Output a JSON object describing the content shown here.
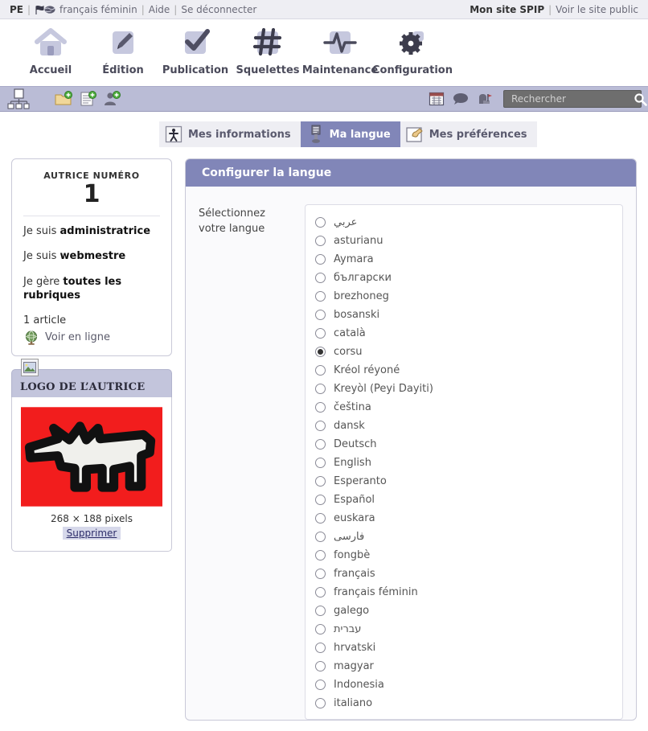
{
  "topbar": {
    "site_abbrev": "PE",
    "sep": "|",
    "language_link": "français féminin",
    "help_link": "Aide",
    "logout_link": "Se déconnecter",
    "site_name": "Mon site SPIP",
    "public_site_link": "Voir le site public",
    "flag_icon": "flags-icon"
  },
  "mainnav": [
    {
      "label": "Accueil",
      "icon": "home-icon"
    },
    {
      "label": "Édition",
      "icon": "pencil-icon"
    },
    {
      "label": "Publication",
      "icon": "checkmark-icon"
    },
    {
      "label": "Squelettes",
      "icon": "hash-icon"
    },
    {
      "label": "Maintenance",
      "icon": "pulse-icon"
    },
    {
      "label": "Configuration",
      "icon": "gear-icon"
    }
  ],
  "subbar": {
    "site_tree_icon": "site-tree-icon",
    "new_folder_icon": "new-rubrique-icon",
    "new_article_icon": "new-article-icon",
    "new_author_icon": "new-author-icon",
    "calendar_icon": "calendar-icon",
    "forum_icon": "forum-bubble-icon",
    "mail_icon": "mailbox-icon",
    "search_placeholder": "Rechercher",
    "search_value": "",
    "search_button_icon": "magnifier-icon"
  },
  "tabs": [
    {
      "label": "Mes informations",
      "icon": "person-icon",
      "active": false
    },
    {
      "label": "Ma langue",
      "icon": "language-icon",
      "active": true
    },
    {
      "label": "Mes préférences",
      "icon": "hand-note-icon",
      "active": false
    }
  ],
  "sidebar": {
    "author_box": {
      "title": "AUTRICE NUMÉRO",
      "number": "1",
      "role_prefix": "Je suis ",
      "role_value": "administratrice",
      "role2_prefix": "Je suis ",
      "role2_value": "webmestre",
      "scope_prefix": "Je gère ",
      "scope_value": "toutes les rubriques",
      "article_count": "1 article",
      "view_online": "Voir en ligne",
      "view_online_icon": "globe-icon"
    },
    "logo_box": {
      "badge_icon": "image-badge-icon",
      "title": "LOGO DE L’AUTRICE",
      "image_alt": "barking-dog-logo",
      "dimensions": "268 × 188 pixels",
      "delete_label": "Supprimer",
      "logo_bg_color": "#f21d1d"
    }
  },
  "panel": {
    "title": "Configurer la langue",
    "field_label": "Sélectionnez votre langue",
    "selected_language": "corsu",
    "languages": [
      {
        "label": "عربي",
        "rtl": true,
        "selected": false
      },
      {
        "label": "asturianu",
        "rtl": false,
        "selected": false
      },
      {
        "label": "Aymara",
        "rtl": false,
        "selected": false
      },
      {
        "label": "български",
        "rtl": false,
        "selected": false
      },
      {
        "label": "brezhoneg",
        "rtl": false,
        "selected": false
      },
      {
        "label": "bosanski",
        "rtl": false,
        "selected": false
      },
      {
        "label": "català",
        "rtl": false,
        "selected": false
      },
      {
        "label": "corsu",
        "rtl": false,
        "selected": true
      },
      {
        "label": "Kréol réyoné",
        "rtl": false,
        "selected": false
      },
      {
        "label": "Kreyòl (Peyi Dayiti)",
        "rtl": false,
        "selected": false
      },
      {
        "label": "čeština",
        "rtl": false,
        "selected": false
      },
      {
        "label": "dansk",
        "rtl": false,
        "selected": false
      },
      {
        "label": "Deutsch",
        "rtl": false,
        "selected": false
      },
      {
        "label": "English",
        "rtl": false,
        "selected": false
      },
      {
        "label": "Esperanto",
        "rtl": false,
        "selected": false
      },
      {
        "label": "Español",
        "rtl": false,
        "selected": false
      },
      {
        "label": "euskara",
        "rtl": false,
        "selected": false
      },
      {
        "label": "فارسی",
        "rtl": true,
        "selected": false
      },
      {
        "label": "fongbè",
        "rtl": false,
        "selected": false
      },
      {
        "label": "français",
        "rtl": false,
        "selected": false
      },
      {
        "label": "français féminin",
        "rtl": false,
        "selected": false
      },
      {
        "label": "galego",
        "rtl": false,
        "selected": false
      },
      {
        "label": "עברית",
        "rtl": true,
        "selected": false
      },
      {
        "label": "hrvatski",
        "rtl": false,
        "selected": false
      },
      {
        "label": "magyar",
        "rtl": false,
        "selected": false
      },
      {
        "label": "Indonesia",
        "rtl": false,
        "selected": false
      },
      {
        "label": "italiano",
        "rtl": false,
        "selected": false
      }
    ]
  },
  "colors": {
    "accent_purple": "#8186b8",
    "subbar_lavender": "#babcd6",
    "topbar_grey": "#eeeef3",
    "logo_header": "#c3c5dc"
  }
}
